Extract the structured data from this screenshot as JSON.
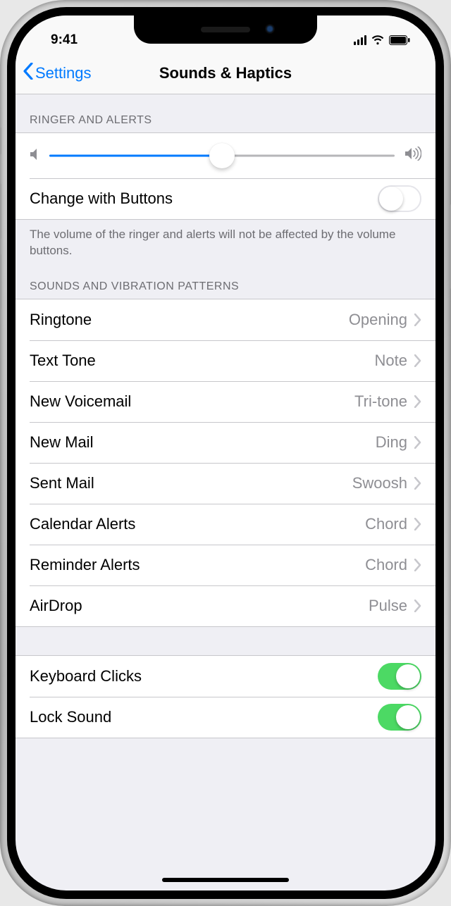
{
  "status": {
    "time": "9:41"
  },
  "nav": {
    "back": "Settings",
    "title": "Sounds & Haptics"
  },
  "ringer": {
    "header": "Ringer and Alerts",
    "volume_percent": 50,
    "change_with_buttons": {
      "label": "Change with Buttons",
      "on": false
    },
    "footer": "The volume of the ringer and alerts will not be affected by the volume buttons."
  },
  "patterns": {
    "header": "Sounds and Vibration Patterns",
    "items": [
      {
        "label": "Ringtone",
        "value": "Opening"
      },
      {
        "label": "Text Tone",
        "value": "Note"
      },
      {
        "label": "New Voicemail",
        "value": "Tri-tone"
      },
      {
        "label": "New Mail",
        "value": "Ding"
      },
      {
        "label": "Sent Mail",
        "value": "Swoosh"
      },
      {
        "label": "Calendar Alerts",
        "value": "Chord"
      },
      {
        "label": "Reminder Alerts",
        "value": "Chord"
      },
      {
        "label": "AirDrop",
        "value": "Pulse"
      }
    ]
  },
  "system_sounds": {
    "items": [
      {
        "label": "Keyboard Clicks",
        "on": true
      },
      {
        "label": "Lock Sound",
        "on": true
      }
    ]
  }
}
